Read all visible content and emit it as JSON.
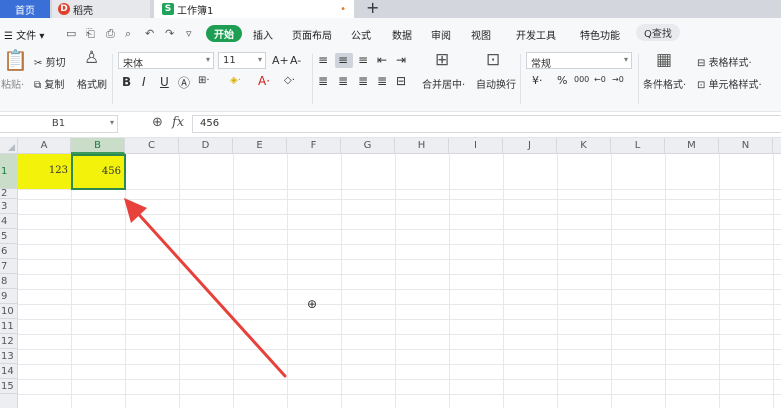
{
  "tabs": {
    "home": "首页",
    "daoke": "稻壳",
    "workbook": "工作簿1",
    "daoke_icon_letter": "D",
    "workbook_icon_letter": "S",
    "unsaved_dot": "•",
    "new_tab": "+"
  },
  "menu": {
    "file": "☰ 文件 ▾",
    "active": "开始",
    "items": [
      "插入",
      "页面布局",
      "公式",
      "数据",
      "审阅",
      "视图",
      "开发工具",
      "特色功能"
    ],
    "search": "Q查找"
  },
  "ribbon": {
    "paste": "粘贴·",
    "cut": "剪切",
    "copy": "复制",
    "format_painter": "格式刷",
    "font_name": "宋体",
    "font_size": "11",
    "number_format": "常规",
    "merge_center": "合并居中·",
    "wrap_text": "自动换行",
    "conditional_format": "条件格式·",
    "table_style": "表格样式·",
    "cell_style": "单元格样式·",
    "bold": "B",
    "italic": "I",
    "underline": "U",
    "grow_font": "A+",
    "shrink_font": "A-",
    "currency": "¥·",
    "percent": "%",
    "thousands": "000"
  },
  "formula_bar": {
    "cell_ref": "B1",
    "fx": "fx",
    "value": "456"
  },
  "grid": {
    "columns": [
      "A",
      "B",
      "C",
      "D",
      "E",
      "F",
      "G",
      "H",
      "I",
      "J",
      "K",
      "L",
      "M",
      "N"
    ],
    "rows": [
      "1",
      "2",
      "3",
      "4",
      "5",
      "6",
      "7",
      "8",
      "9",
      "10",
      "11",
      "12",
      "13",
      "14",
      "15"
    ],
    "cells": {
      "A1": "123",
      "B1": "456"
    },
    "selected_cell": "B1",
    "highlight_color": "#f2f20a",
    "annotation_arrow_color": "#e8403a"
  }
}
